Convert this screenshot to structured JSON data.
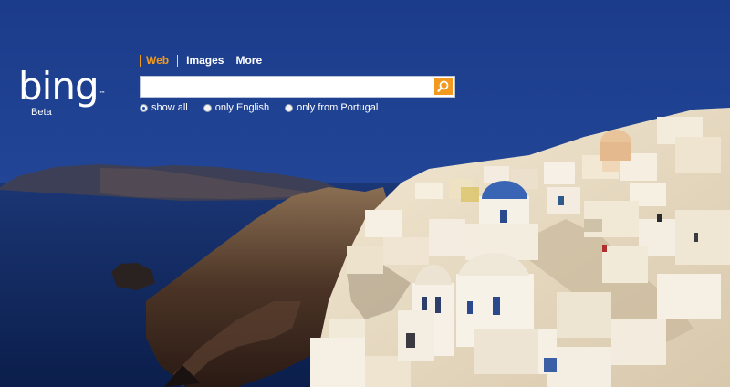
{
  "brand": {
    "logo_text": "bing",
    "trademark": "™",
    "badge": "Beta"
  },
  "nav": {
    "items": [
      "Web",
      "Images",
      "More"
    ],
    "active": "Web"
  },
  "search": {
    "value": "",
    "placeholder": "",
    "button_icon": "magnifier-icon"
  },
  "scope_options": [
    {
      "label": "show all",
      "selected": true
    },
    {
      "label": "only English",
      "selected": false
    },
    {
      "label": "only from Portugal",
      "selected": false
    }
  ],
  "colors": {
    "accent": "#f39a1e",
    "sky": "#1d3f8e",
    "sea": "#0f2c6b"
  },
  "background_icon": "santorini-landscape"
}
